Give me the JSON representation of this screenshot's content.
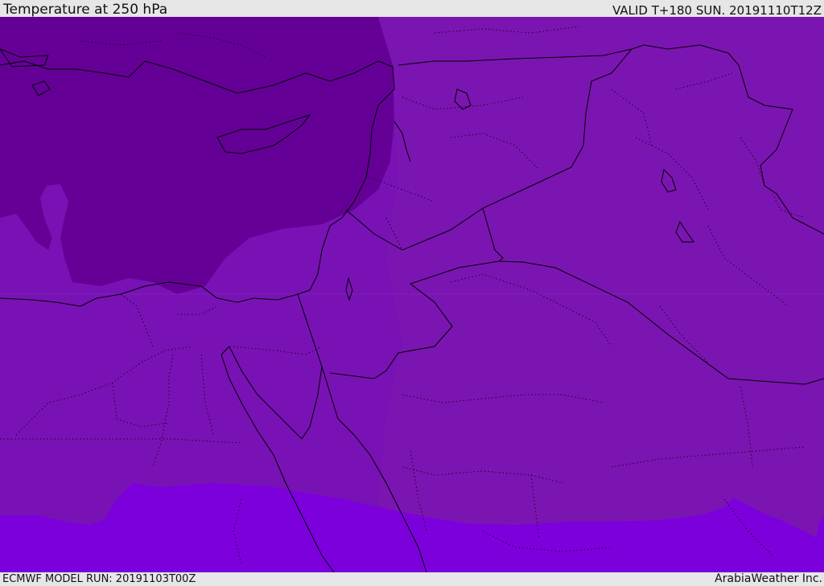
{
  "header": {
    "title": "Temperature at 250 hPa",
    "valid_time": "VALID T+180 SUN. 20191110T12Z"
  },
  "footer": {
    "model_run": "ECMWF MODEL RUN: 20191103T00Z",
    "credit": "ArabiaWeather Inc."
  },
  "map": {
    "field": "temperature-250hPa",
    "colors": {
      "dark_band": "#650097",
      "mid_band": "#7912b5",
      "east_band": "#7b15b2",
      "light_band": "#7c00dc",
      "border_line": "#000000",
      "admin_line": "#1a0026"
    }
  }
}
